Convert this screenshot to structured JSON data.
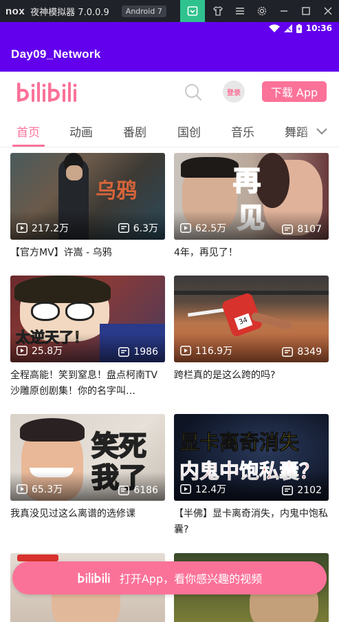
{
  "emulator": {
    "logo": "nox",
    "title": "夜神模拟器 7.0.0.9",
    "android_version": "Android 7"
  },
  "status_bar": {
    "time": "10:36"
  },
  "app_bar": {
    "title": "Day09_Network"
  },
  "header": {
    "logo_text": "bilibili",
    "login_label": "登录",
    "download_label": "下载 App"
  },
  "tabs": [
    "首页",
    "动画",
    "番剧",
    "国创",
    "音乐",
    "舞蹈"
  ],
  "videos": [
    {
      "views": "217.2万",
      "comments": "6.3万",
      "title": "【官方MV】许嵩 - 乌鸦",
      "overlay": "乌鸦"
    },
    {
      "views": "62.5万",
      "comments": "8107",
      "title": "4年，再见了！",
      "overlay": "再见"
    },
    {
      "views": "25.8万",
      "comments": "1986",
      "title": "全程高能！笑到窒息！盘点柯南TV沙雕原创剧集！你的名字叫…",
      "overlay": "太逆天了！"
    },
    {
      "views": "116.9万",
      "comments": "8349",
      "title": "跨栏真的是这么跨的吗?",
      "overlay": ""
    },
    {
      "views": "65.3万",
      "comments": "6186",
      "title": "我真没见过这么离谱的选修课",
      "overlay": "笑死我了"
    },
    {
      "views": "12.4万",
      "comments": "2102",
      "title": "【半佛】显卡离奇消失，内鬼中饱私囊?",
      "overlay": "显卡离奇消失 内鬼中饱私囊？"
    }
  ],
  "open_app_banner": {
    "logo_text": "bilibili",
    "label": "打开App，看你感兴趣的视频"
  },
  "colors": {
    "accent": "#fb7299",
    "app_bar": "#6200ee"
  }
}
